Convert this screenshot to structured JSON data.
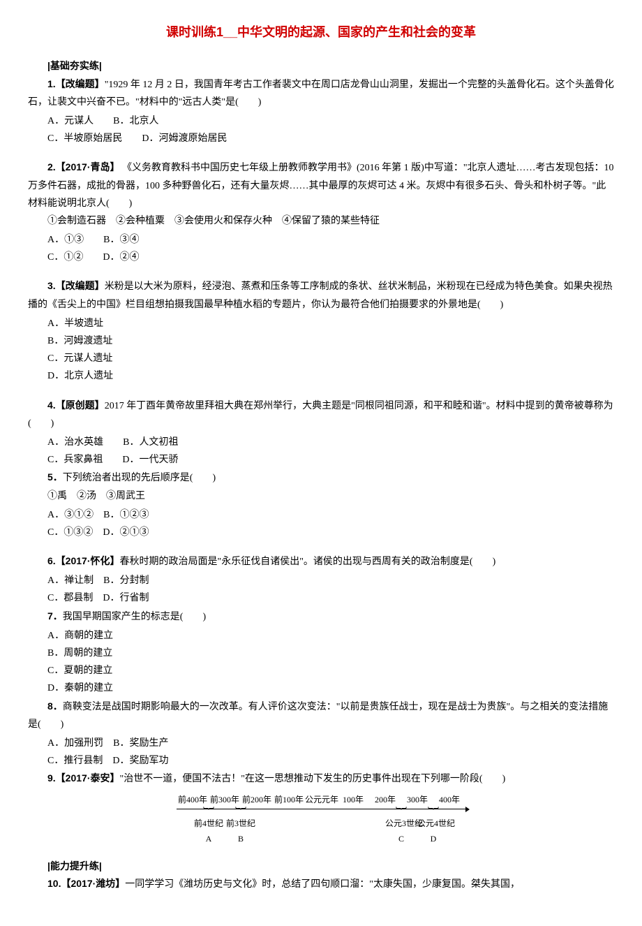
{
  "title": "课时训练1__中华文明的起源、国家的产生和社会的变革",
  "section1_header": "|基础夯实练|",
  "q1": {
    "num": "1.",
    "tag": "【改编题】",
    "text": "\"1929 年 12 月 2 日，我国青年考古工作者裴文中在周口店龙骨山山洞里，发掘出一个完整的头盖骨化石。这个头盖骨化石，让裴文中兴奋不已。\"材料中的\"远古人类\"是(　　)",
    "opt_a": "A．元谋人",
    "opt_b": "B．北京人",
    "opt_c": "C．半坡原始居民",
    "opt_d": "D．河姆渡原始居民"
  },
  "q2": {
    "num": "2.",
    "tag": "【2017·青岛】",
    "text": " 《义务教育教科书中国历史七年级上册教师教学用书》(2016 年第 1 版)中写道：\"北京人遗址……考古发现包括：10 万多件石器，成批的骨器，100 多种野兽化石，还有大量灰烬……其中最厚的灰烬可达 4 米。灰烬中有很多石头、骨头和朴树子等。\"此材料能说明北京人(　　)",
    "sub": "①会制造石器　②会种植粟　③会使用火和保存火种　④保留了猿的某些特征",
    "opt_a": "A．①③",
    "opt_b": "B．③④",
    "opt_c": "C．①②",
    "opt_d": "D．②④"
  },
  "q3": {
    "num": "3.",
    "tag": "【改编题】",
    "text": "米粉是以大米为原料，经浸泡、蒸煮和压条等工序制成的条状、丝状米制品，米粉现在已经成为特色美食。如果央视热播的《舌尖上的中国》栏目组想拍摄我国最早种植水稻的专题片，你认为最符合他们拍摄要求的外景地是(　　)",
    "opt_a": "A．半坡遗址",
    "opt_b": "B．河姆渡遗址",
    "opt_c": "C．元谋人遗址",
    "opt_d": "D．北京人遗址"
  },
  "q4": {
    "num": "4.",
    "tag": "【原创题】",
    "text": "2017 年丁酉年黄帝故里拜祖大典在郑州举行，大典主题是\"同根同祖同源，和平和睦和谐\"。材料中提到的黄帝被尊称为(　　)",
    "opt_a": "A．治水英雄",
    "opt_b": "B．人文初祖",
    "opt_c": "C．兵家鼻祖",
    "opt_d": "D．一代天骄"
  },
  "q5": {
    "num": "5．",
    "text": "下列统治者出现的先后顺序是(　　)",
    "sub": "①禹　②汤　③周武王",
    "opt_a": "A．③①②",
    "opt_b": "B．①②③",
    "opt_c": "C．①③②",
    "opt_d": "D．②①③"
  },
  "q6": {
    "num": "6.",
    "tag": "【2017·怀化】",
    "text": "春秋时期的政治局面是\"永乐征伐自诸侯出\"。诸侯的出现与西周有关的政治制度是(　　)",
    "opt_a": "A．禅让制",
    "opt_b": "B．分封制",
    "opt_c": "C．郡县制",
    "opt_d": "D．行省制"
  },
  "q7": {
    "num": "7．",
    "text": "我国早期国家产生的标志是(　　)",
    "opt_a": "A．商朝的建立",
    "opt_b": "B．周朝的建立",
    "opt_c": "C．夏朝的建立",
    "opt_d": "D．秦朝的建立"
  },
  "q8": {
    "num": "8．",
    "text": "商鞅变法是战国时期影响最大的一次改革。有人评价这次变法：\"以前是贵族任战士，现在是战士为贵族\"。与之相关的变法措施是(　　)",
    "opt_a": "A．加强刑罚",
    "opt_b": "B．奖励生产",
    "opt_c": "C．推行县制",
    "opt_d": "D．奖励军功"
  },
  "q9": {
    "num": "9.",
    "tag": "【2017·泰安】",
    "text": "\"治世不一道，便国不法古！\"在这一思想推动下发生的历史事件出现在下列哪一阶段(　　)"
  },
  "timeline": {
    "top": [
      "前400年",
      "前300年",
      "前200年",
      "前100年",
      "公元元年",
      "100年",
      "200年",
      "300年",
      "400年"
    ],
    "labels": [
      "前4世纪",
      "前3世纪",
      "公元3世纪",
      "公元4世纪"
    ],
    "letters": [
      "A",
      "B",
      "C",
      "D"
    ]
  },
  "section2_header": "|能力提升练|",
  "q10": {
    "num": "10.",
    "tag": "【2017·潍坊】",
    "text": "一同学学习《潍坊历史与文化》时，总结了四句顺口溜：\"太康失国，少康复国。桀失其国，"
  }
}
